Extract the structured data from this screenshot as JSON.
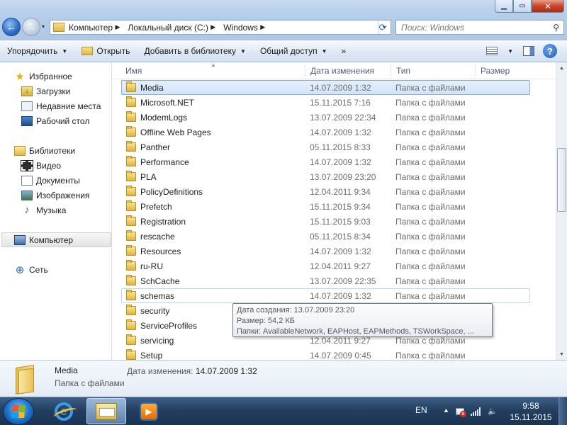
{
  "window": {
    "controls": {
      "minimize": "▁",
      "maximize": "▭",
      "close": "✕"
    }
  },
  "nav": {
    "back_icon": "back-arrow-icon",
    "forward_icon": "forward-arrow-icon",
    "back_glyph": "←",
    "forward_glyph": "→",
    "history_glyph": "▾"
  },
  "address": {
    "crumbs": [
      "Компьютер",
      "Локальный диск (C:)",
      "Windows"
    ],
    "separator": "▶",
    "dropdown_glyph": "▾",
    "refresh_glyph": "⟳"
  },
  "search": {
    "placeholder": "Поиск: Windows",
    "icon_glyph": "⚲"
  },
  "toolbar": {
    "organize": "Упорядочить",
    "open": "Открыть",
    "add_to_library": "Добавить в библиотеку",
    "share": "Общий доступ",
    "more": "»",
    "dropdown_glyph": "▼",
    "help_glyph": "?"
  },
  "navpane": {
    "favorites": {
      "label": "Избранное",
      "icon": "star-icon",
      "glyph": "★"
    },
    "favorites_items": [
      {
        "label": "Загрузки",
        "icon": "downloads-icon"
      },
      {
        "label": "Недавние места",
        "icon": "recent-places-icon"
      },
      {
        "label": "Рабочий стол",
        "icon": "desktop-icon"
      }
    ],
    "libraries": {
      "label": "Библиотеки",
      "icon": "libraries-icon"
    },
    "libraries_items": [
      {
        "label": "Видео",
        "icon": "video-icon"
      },
      {
        "label": "Документы",
        "icon": "documents-icon"
      },
      {
        "label": "Изображения",
        "icon": "pictures-icon"
      },
      {
        "label": "Музыка",
        "icon": "music-icon",
        "glyph": "♪"
      }
    ],
    "computer": {
      "label": "Компьютер",
      "icon": "computer-icon"
    },
    "network": {
      "label": "Сеть",
      "icon": "network-icon",
      "glyph": "⊕"
    }
  },
  "columns": {
    "name": "Имя",
    "date": "Дата изменения",
    "type": "Тип",
    "size": "Размер",
    "sort_glyph": "▲"
  },
  "files": [
    {
      "name": "Media",
      "date": "14.07.2009 1:32",
      "type": "Папка с файлами",
      "state": "selected"
    },
    {
      "name": "Microsoft.NET",
      "date": "15.11.2015 7:16",
      "type": "Папка с файлами"
    },
    {
      "name": "ModemLogs",
      "date": "13.07.2009 22:34",
      "type": "Папка с файлами"
    },
    {
      "name": "Offline Web Pages",
      "date": "14.07.2009 1:32",
      "type": "Папка с файлами"
    },
    {
      "name": "Panther",
      "date": "05.11.2015 8:33",
      "type": "Папка с файлами"
    },
    {
      "name": "Performance",
      "date": "14.07.2009 1:32",
      "type": "Папка с файлами"
    },
    {
      "name": "PLA",
      "date": "13.07.2009 23:20",
      "type": "Папка с файлами"
    },
    {
      "name": "PolicyDefinitions",
      "date": "12.04.2011 9:34",
      "type": "Папка с файлами"
    },
    {
      "name": "Prefetch",
      "date": "15.11.2015 9:34",
      "type": "Папка с файлами"
    },
    {
      "name": "Registration",
      "date": "15.11.2015 9:03",
      "type": "Папка с файлами"
    },
    {
      "name": "rescache",
      "date": "05.11.2015 8:34",
      "type": "Папка с файлами"
    },
    {
      "name": "Resources",
      "date": "14.07.2009 1:32",
      "type": "Папка с файлами"
    },
    {
      "name": "ru-RU",
      "date": "12.04.2011 9:27",
      "type": "Папка с файлами"
    },
    {
      "name": "SchCache",
      "date": "13.07.2009 22:35",
      "type": "Папка с файлами"
    },
    {
      "name": "schemas",
      "date": "14.07.2009 1:32",
      "type": "Папка с файлами",
      "state": "hover"
    },
    {
      "name": "security",
      "date": "",
      "type": ""
    },
    {
      "name": "ServiceProfiles",
      "date": "",
      "type": ""
    },
    {
      "name": "servicing",
      "date": "12.04.2011 9:27",
      "type": "Папка с файлами"
    },
    {
      "name": "Setup",
      "date": "14.07.2009 0:45",
      "type": "Папка с файлами"
    }
  ],
  "tooltip": {
    "created": "Дата создания: 13.07.2009 23:20",
    "size": "Размер: 54,2 КБ",
    "folders": "Папки: AvailableNetwork, EAPHost, EAPMethods, TSWorkSpace, ..."
  },
  "scrollbar": {
    "up_glyph": "▲",
    "down_glyph": "▼"
  },
  "details": {
    "name": "Media",
    "type": "Папка с файлами",
    "modified_label": "Дата изменения:",
    "modified_value": "14.07.2009 1:32"
  },
  "taskbar": {
    "apps": [
      {
        "name": "internet-explorer",
        "icon": "internet-explorer-icon",
        "glyph": "e"
      },
      {
        "name": "windows-explorer",
        "icon": "windows-explorer-icon",
        "active": true
      },
      {
        "name": "media-player",
        "icon": "media-player-icon",
        "glyph": "▶"
      }
    ],
    "lang": "EN",
    "tray_arrow": "▲",
    "volume_glyph": "🔈",
    "time": "9:58",
    "date": "15.11.2015"
  }
}
